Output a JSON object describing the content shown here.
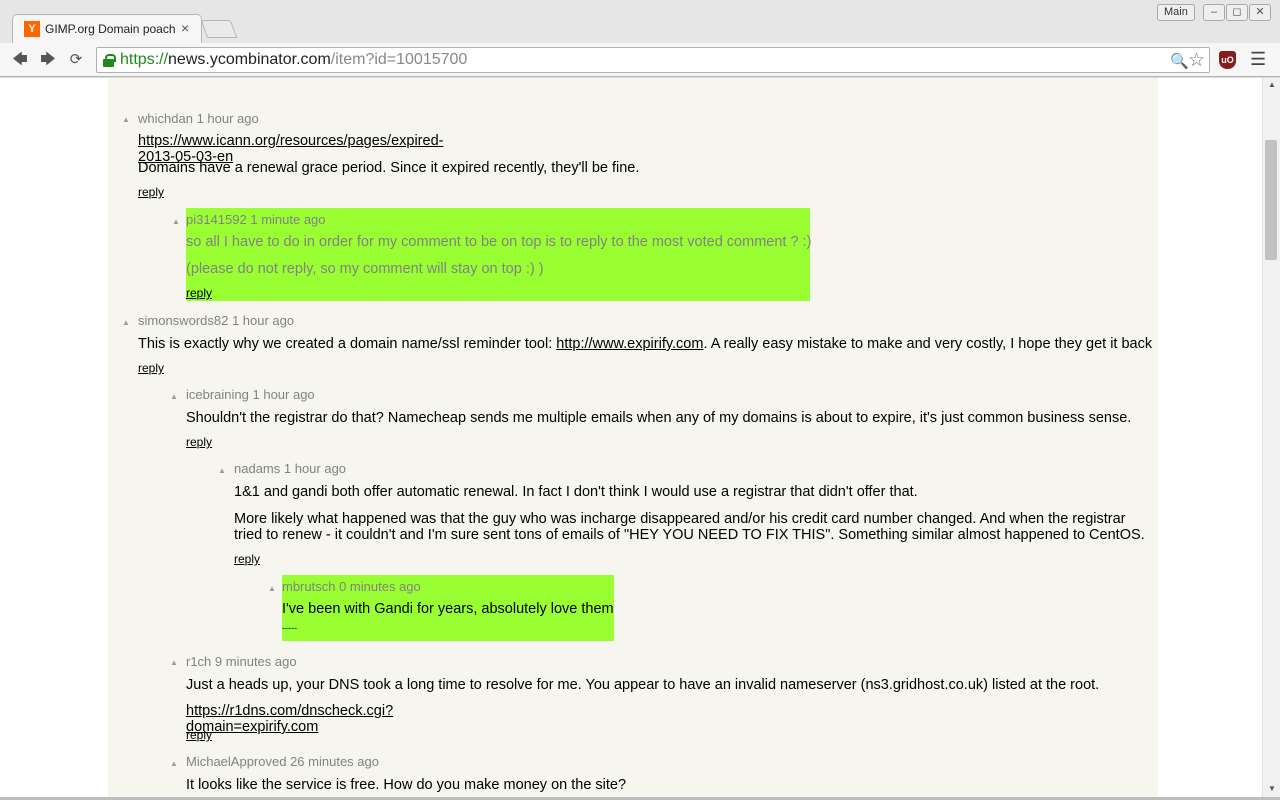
{
  "browser": {
    "tab_title": "GIMP.org Domain poach",
    "tab_favicon": "Y",
    "tab_close": "×",
    "profile": "Main",
    "url_scheme": "https://",
    "url_host": "news.ycombinator.com",
    "url_path": "/item?id=10015700",
    "icons": [
      "back-icon",
      "forward-icon",
      "reload-icon",
      "lock-icon",
      "zoom-icon",
      "star-icon",
      "ublock-icon",
      "menu-icon"
    ]
  },
  "comments": [
    {
      "user": "whichdan",
      "age": "1 hour ago",
      "paragraphs": [
        {
          "link": "https://www.icann.org/resources/pages/expired-2013-05-03-en"
        },
        {
          "text": "Domains have a renewal grace period. Since it expired recently, they'll be fine."
        }
      ],
      "reply": "reply"
    },
    {
      "user": "pi3141592",
      "age": "1 minute ago",
      "paragraphs": [
        {
          "text": "so all I have to do in order for my comment to be on top is to reply to the most voted comment ? :)"
        },
        {
          "text": "(please do not reply, so my comment will stay on top :) )"
        }
      ],
      "reply": "reply"
    },
    {
      "user": "simonswords82",
      "age": "1 hour ago",
      "paragraphs": [
        {
          "before": "This is exactly why we created a domain name/ssl reminder tool: ",
          "link": "http://www.expirify.com",
          "after": ". A really easy mistake to make and very costly, I hope they get it back"
        }
      ],
      "reply": "reply"
    },
    {
      "user": "icebraining",
      "age": "1 hour ago",
      "paragraphs": [
        {
          "text": "Shouldn't the registrar do that? Namecheap sends me multiple emails when any of my domains is about to expire, it's just common business sense."
        }
      ],
      "reply": "reply"
    },
    {
      "user": "nadams",
      "age": "1 hour ago",
      "paragraphs": [
        {
          "text": "1&1 and gandi both offer automatic renewal. In fact I don't think I would use a registrar that didn't offer that."
        },
        {
          "text": "More likely what happened was that the guy who was incharge disappeared and/or his credit card number changed. And when the registrar tried to renew - it couldn't and I'm sure sent tons of emails of \"HEY YOU NEED TO FIX THIS\". Something similar almost happened to CentOS."
        }
      ],
      "reply": "reply"
    },
    {
      "user": "mbrutsch",
      "age": "0 minutes ago",
      "paragraphs": [
        {
          "text": "I've been with Gandi for years, absolutely love them"
        }
      ],
      "reply": "-----"
    },
    {
      "user": "r1ch",
      "age": "9 minutes ago",
      "paragraphs": [
        {
          "text": "Just a heads up, your DNS took a long time to resolve for me. You appear to have an invalid nameserver (ns3.gridhost.co.uk) listed at the root."
        },
        {
          "link": "https://r1dns.com/dnscheck.cgi?domain=expirify.com"
        }
      ],
      "reply": "reply"
    },
    {
      "user": "MichaelApproved",
      "age": "26 minutes ago",
      "paragraphs": [
        {
          "text": "It looks like the service is free. How do you make money on the site?"
        }
      ],
      "reply": ""
    }
  ]
}
